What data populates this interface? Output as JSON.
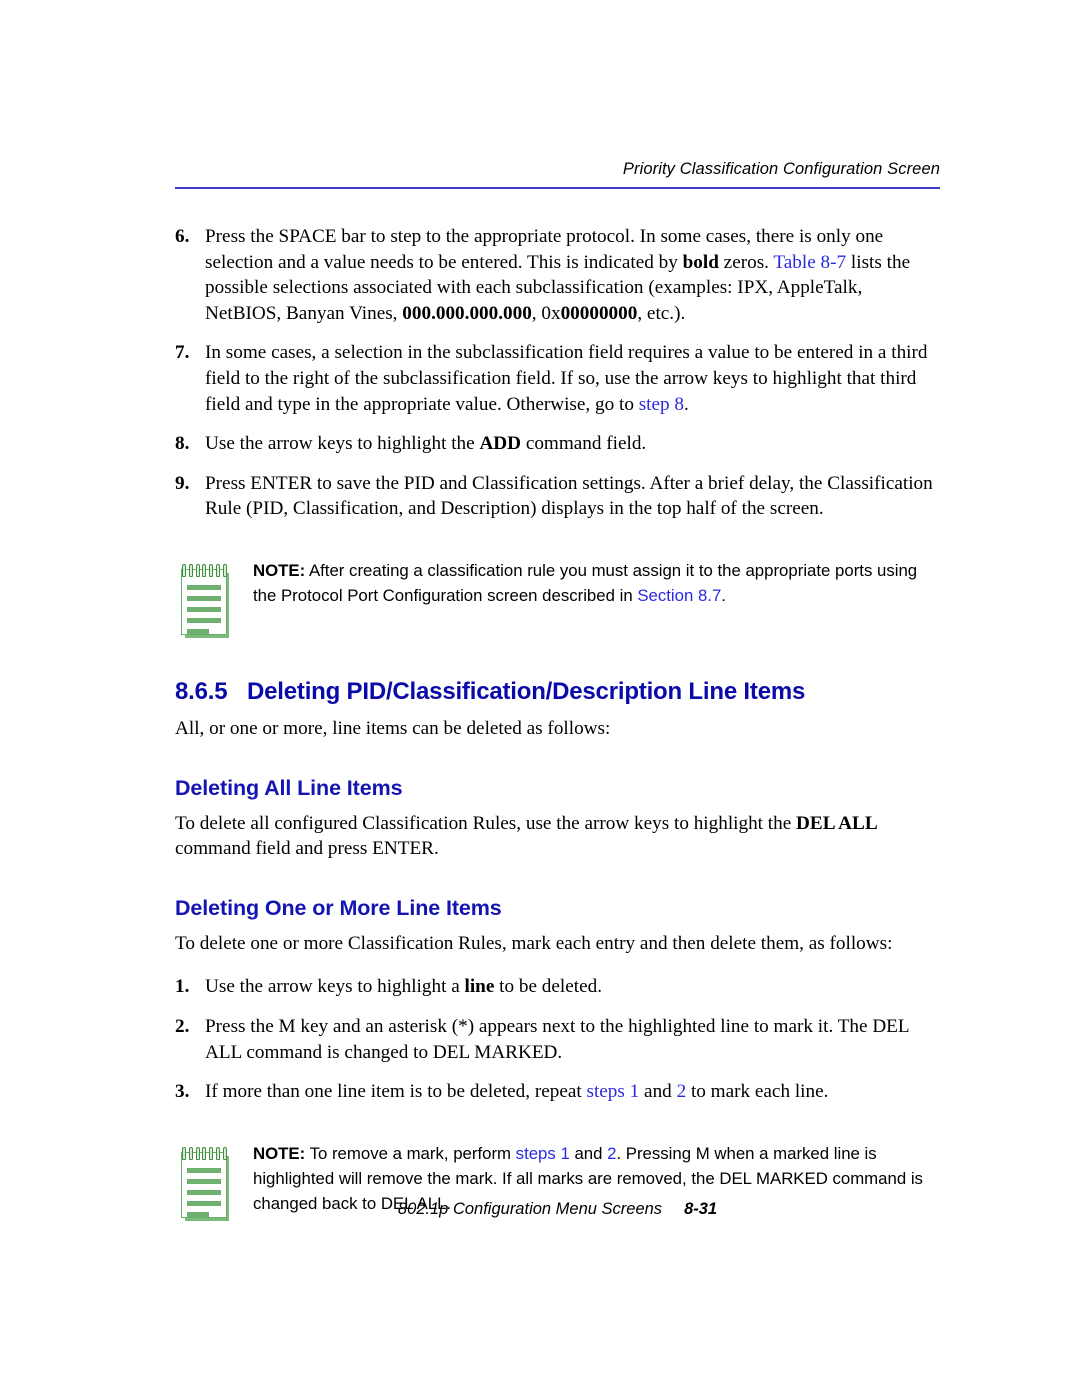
{
  "header": {
    "title": "Priority Classification Configuration Screen",
    "rule_color": "#3b3bc4"
  },
  "colors": {
    "link_blue": "#2a2ae0",
    "heading_blue": "#0a0aaa",
    "subheading_blue": "#1414b4",
    "note_icon_green": "#6faf6f",
    "rule_blue": "#3b3bc4"
  },
  "steps_upper": [
    {
      "number": "6.",
      "runs": [
        {
          "text": "Press the SPACE bar to step to the appropriate protocol. In some cases, there is only one selection and a value needs to be entered. This is indicated by ",
          "style": "normal"
        },
        {
          "text": "bold",
          "style": "bold"
        },
        {
          "text": " zeros. ",
          "style": "normal"
        },
        {
          "text": "Table 8-7",
          "style": "link"
        },
        {
          "text": " lists the possible selections associated with each subclassification (examples: IPX, AppleTalk, NetBIOS, Banyan Vines, ",
          "style": "normal"
        },
        {
          "text": "000.000.000.000",
          "style": "bold"
        },
        {
          "text": ", 0x",
          "style": "normal"
        },
        {
          "text": "00000000",
          "style": "bold"
        },
        {
          "text": ", etc.).",
          "style": "normal"
        }
      ]
    },
    {
      "number": "7.",
      "runs": [
        {
          "text": "In some cases, a selection in the subclassification field requires a value to be entered in a third field to the right of the subclassification field. If so, use the arrow keys to highlight that third field and type in the appropriate value. Otherwise, go to ",
          "style": "normal"
        },
        {
          "text": "step 8",
          "style": "link"
        },
        {
          "text": ".",
          "style": "normal"
        }
      ]
    },
    {
      "number": "8.",
      "runs": [
        {
          "text": "Use the arrow keys to highlight the ",
          "style": "normal"
        },
        {
          "text": "ADD",
          "style": "bold"
        },
        {
          "text": " command field.",
          "style": "normal"
        }
      ]
    },
    {
      "number": "9.",
      "runs": [
        {
          "text": "Press ENTER to save the PID and Classification settings. After a brief delay, the Classification Rule (PID, Classification, and Description) displays in the top half of the screen.",
          "style": "normal"
        }
      ]
    }
  ],
  "note_one": {
    "icon_name": "note-pad-icon",
    "runs": [
      {
        "text": "NOTE:",
        "style": "bold"
      },
      {
        "text": "  After creating a classification rule you must assign it to the appropriate ports using the Protocol Port Configuration screen described in ",
        "style": "normal"
      },
      {
        "text": "Section 8.7",
        "style": "link"
      },
      {
        "text": ".",
        "style": "normal"
      }
    ]
  },
  "section": {
    "number": "8.6.5",
    "title": "Deleting PID/Classification/Description Line Items",
    "intro": "All, or one or more, line items can be deleted as follows:"
  },
  "sub_all": {
    "title": "Deleting All Line Items",
    "runs": [
      {
        "text": "To delete all configured Classification Rules, use the arrow keys to highlight the ",
        "style": "normal"
      },
      {
        "text": "DEL ALL",
        "style": "bold"
      },
      {
        "text": " command field and press ENTER.",
        "style": "normal"
      }
    ]
  },
  "sub_more": {
    "title": "Deleting One or More Line Items",
    "intro": "To delete one or more Classification Rules, mark each entry and then delete them, as follows:",
    "steps": [
      {
        "number": "1.",
        "runs": [
          {
            "text": "Use the arrow keys to highlight a ",
            "style": "normal"
          },
          {
            "text": "line",
            "style": "bold"
          },
          {
            "text": " to be deleted.",
            "style": "normal"
          }
        ]
      },
      {
        "number": "2.",
        "runs": [
          {
            "text": "Press the M key and an asterisk (*) appears next to the highlighted line to mark it. The DEL ALL command is changed to DEL MARKED.",
            "style": "normal"
          }
        ]
      },
      {
        "number": "3.",
        "runs": [
          {
            "text": "If more than one line item is to be deleted, repeat ",
            "style": "normal"
          },
          {
            "text": "steps 1",
            "style": "link"
          },
          {
            "text": " and ",
            "style": "normal"
          },
          {
            "text": "2",
            "style": "link"
          },
          {
            "text": " to mark each line.",
            "style": "normal"
          }
        ]
      }
    ]
  },
  "note_two": {
    "icon_name": "note-pad-icon",
    "runs": [
      {
        "text": "NOTE:",
        "style": "bold"
      },
      {
        "text": "  To remove a mark, perform ",
        "style": "normal"
      },
      {
        "text": "steps 1",
        "style": "link"
      },
      {
        "text": " and ",
        "style": "normal"
      },
      {
        "text": "2",
        "style": "link"
      },
      {
        "text": ". Pressing M when a marked line is highlighted will remove the mark. If all marks are removed, the DEL MARKED command is changed back to DEL ALL.",
        "style": "normal"
      }
    ]
  },
  "footer": {
    "text": "802.1p Configuration Menu Screens",
    "page": "8-31"
  }
}
